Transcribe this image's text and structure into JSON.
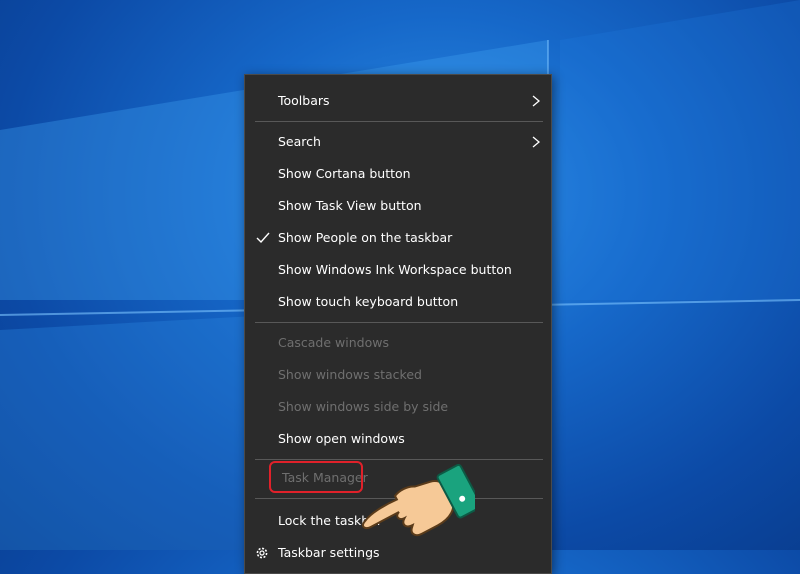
{
  "desktop": {
    "accent_color": "#1668c9"
  },
  "context_menu": {
    "items": [
      {
        "label": "Toolbars"
      },
      {
        "label": "Search"
      },
      {
        "label": "Show Cortana button"
      },
      {
        "label": "Show Task View button"
      },
      {
        "label": "Show People on the taskbar"
      },
      {
        "label": "Show Windows Ink Workspace button"
      },
      {
        "label": "Show touch keyboard button"
      },
      {
        "label": "Cascade windows"
      },
      {
        "label": "Show windows stacked"
      },
      {
        "label": "Show windows side by side"
      },
      {
        "label": "Show open windows"
      },
      {
        "label": "Task Manager"
      },
      {
        "label": "Lock the taskbar"
      },
      {
        "label": "Taskbar settings"
      }
    ],
    "highlight_color": "#e0212a"
  }
}
